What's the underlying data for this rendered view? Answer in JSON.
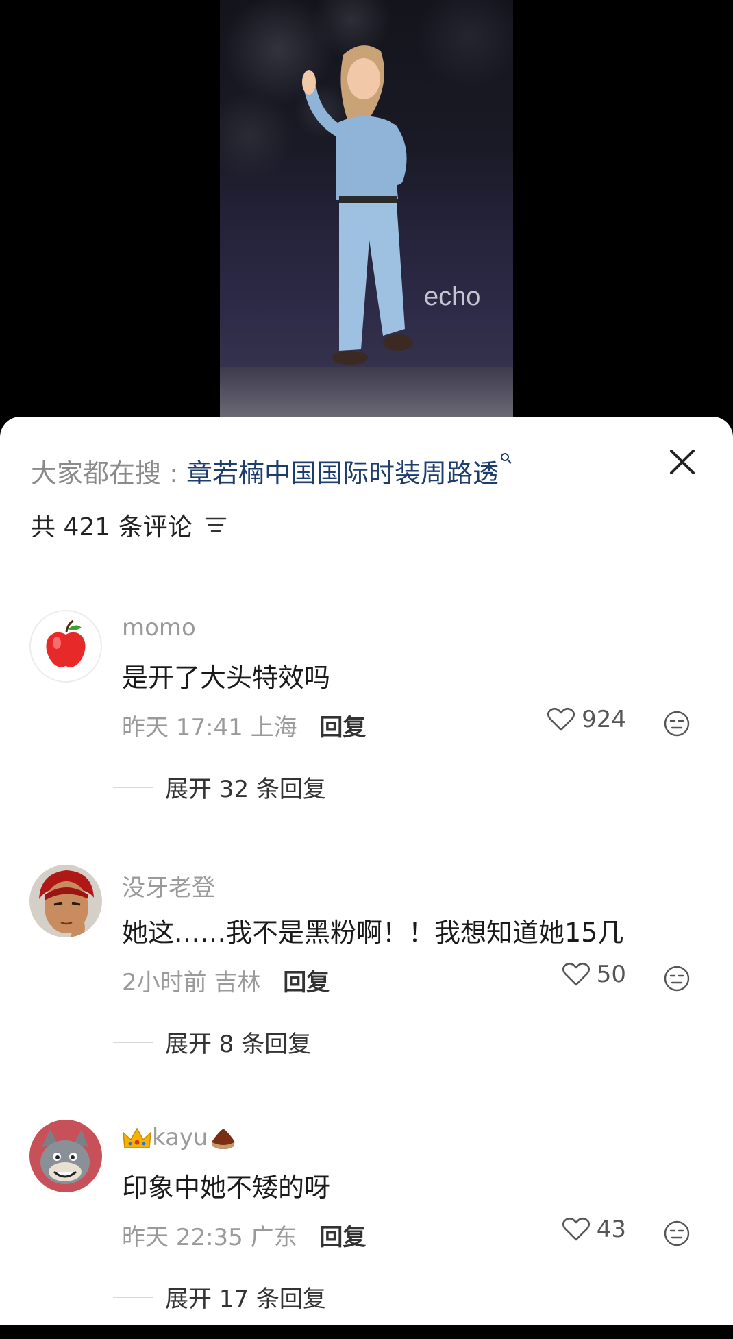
{
  "video": {
    "watermark": "echo"
  },
  "search_bar": {
    "prefix": "大家都在搜 : ",
    "term": "章若楠中国国际时装周路透"
  },
  "comments_header": {
    "count_text": "共 421 条评论"
  },
  "comments": [
    {
      "username": "momo",
      "text": "是开了大头特效吗",
      "time": "昨天 17:41",
      "location": "上海",
      "reply_label": "回复",
      "likes": "924",
      "expand_text": "展开 32 条回复",
      "avatar": "apple-icon"
    },
    {
      "username": "没牙老登",
      "text": "她这……我不是黑粉啊！！我想知道她15几",
      "time": "2小时前",
      "location": "吉林",
      "reply_label": "回复",
      "likes": "50",
      "expand_text": "展开 8 条回复",
      "avatar": "anime-character-avatar"
    },
    {
      "username": "kayu",
      "text": "印象中她不矮的呀",
      "time": "昨天 22:35",
      "location": "广东",
      "reply_label": "回复",
      "likes": "43",
      "expand_text": "展开 17 条回复",
      "avatar": "cartoon-cat-avatar",
      "badges": [
        "crown-emoji",
        "chestnut-emoji"
      ]
    }
  ],
  "colors": {
    "search_term": "#1c3d6e",
    "muted_text": "#9a9a9a",
    "sheet_bg": "#ffffff",
    "video_bg": "#000000"
  }
}
